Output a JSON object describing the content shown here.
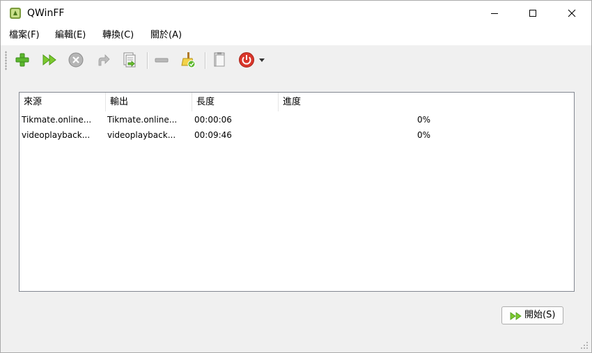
{
  "window": {
    "title": "QWinFF"
  },
  "menu": {
    "items": [
      {
        "label": "檔案(F)"
      },
      {
        "label": "編輯(E)"
      },
      {
        "label": "轉換(C)"
      },
      {
        "label": "關於(A)"
      }
    ]
  },
  "toolbar": {
    "buttons": [
      "add-icon",
      "convert-icon",
      "stop-icon",
      "redo-icon",
      "output-folder-icon",
      "remove-icon",
      "clear-list-icon",
      "paste-icon",
      "power-icon",
      "dropdown-arrow-icon"
    ]
  },
  "table": {
    "columns": [
      "來源",
      "輸出",
      "長度",
      "進度"
    ],
    "rows": [
      {
        "source": "Tikmate.online...",
        "output": "Tikmate.online...",
        "duration": "00:00:06",
        "progress": "0%"
      },
      {
        "source": "videoplayback...",
        "output": "videoplayback...",
        "duration": "00:09:46",
        "progress": "0%"
      }
    ]
  },
  "start_button": {
    "label": "開始(S)"
  },
  "colors": {
    "accent_green": "#5cb82e",
    "power_red": "#d9362b"
  }
}
